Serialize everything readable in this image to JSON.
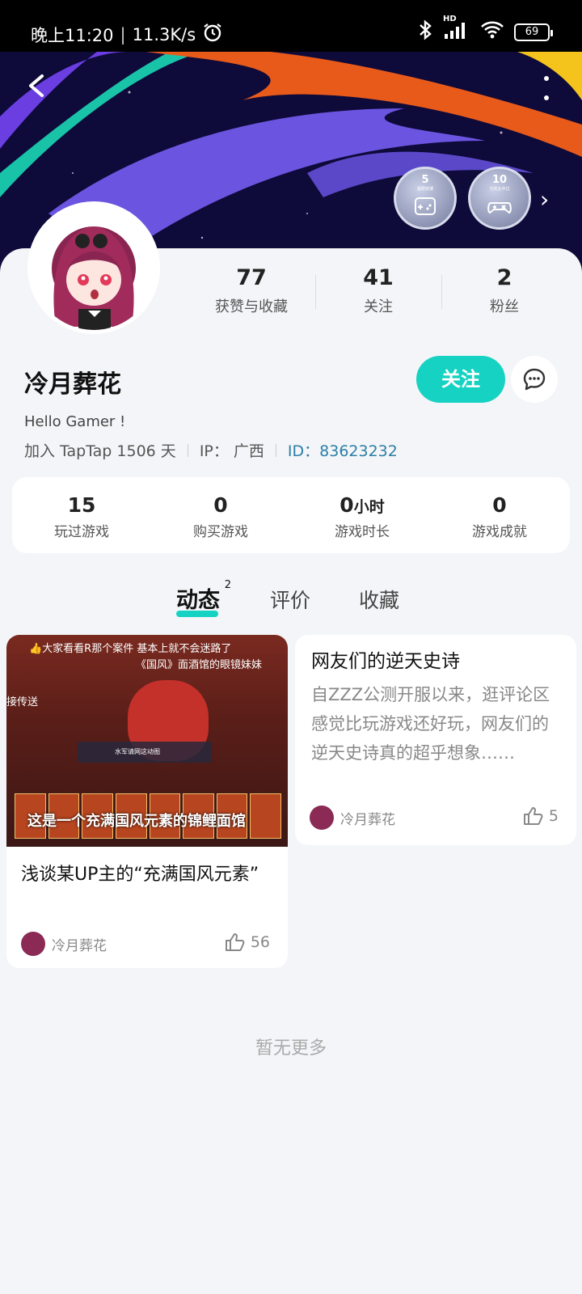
{
  "status_bar": {
    "time": "晚上11:20",
    "speed": "11.3K/s",
    "battery": "69",
    "signal_label": "HD"
  },
  "header": {
    "badges": [
      {
        "num": "5",
        "caption": "极限拼搏"
      },
      {
        "num": "10",
        "caption": "万花丛中过"
      }
    ]
  },
  "profile": {
    "name": "冷月葬花",
    "bio": "Hello Gamer !",
    "joined": "加入 TapTap 1506 天",
    "ip": "IP： 广西",
    "id": "ID：83623232",
    "follow_label": "关注",
    "top_stats": [
      {
        "value": "77",
        "label": "获赞与收藏"
      },
      {
        "value": "41",
        "label": "关注"
      },
      {
        "value": "2",
        "label": "粉丝"
      }
    ]
  },
  "game_stats": [
    {
      "value": "15",
      "unit": "",
      "label": "玩过游戏"
    },
    {
      "value": "0",
      "unit": "",
      "label": "购买游戏"
    },
    {
      "value": "0",
      "unit": "小时",
      "label": "游戏时长"
    },
    {
      "value": "0",
      "unit": "",
      "label": "游戏成就"
    }
  ],
  "tabs": [
    {
      "label": "动态",
      "count": "2"
    },
    {
      "label": "评价"
    },
    {
      "label": "收藏"
    }
  ],
  "posts": [
    {
      "thumb_top_caption": "👍大家看看R那个案件 基本上就不会迷路了",
      "thumb_sub_caption": "《国风》面酒馆的眼镜妹妹",
      "thumb_left_caption": "接传送",
      "thumb_popup": "水军请网这动图",
      "thumb_banner": "这是一个充满国风元素的锦鲤面馆",
      "title": "浅谈某UP主的“充满国风元素”",
      "author": "冷月葬花",
      "likes": "56"
    },
    {
      "title": "网友们的逆天史诗",
      "text": "自ZZZ公测开服以来，逛评论区感觉比玩游戏还好玩，网友们的逆天史诗真的超乎想象……",
      "author": "冷月葬花",
      "likes": "5"
    }
  ],
  "footer": {
    "no_more": "暂无更多"
  }
}
